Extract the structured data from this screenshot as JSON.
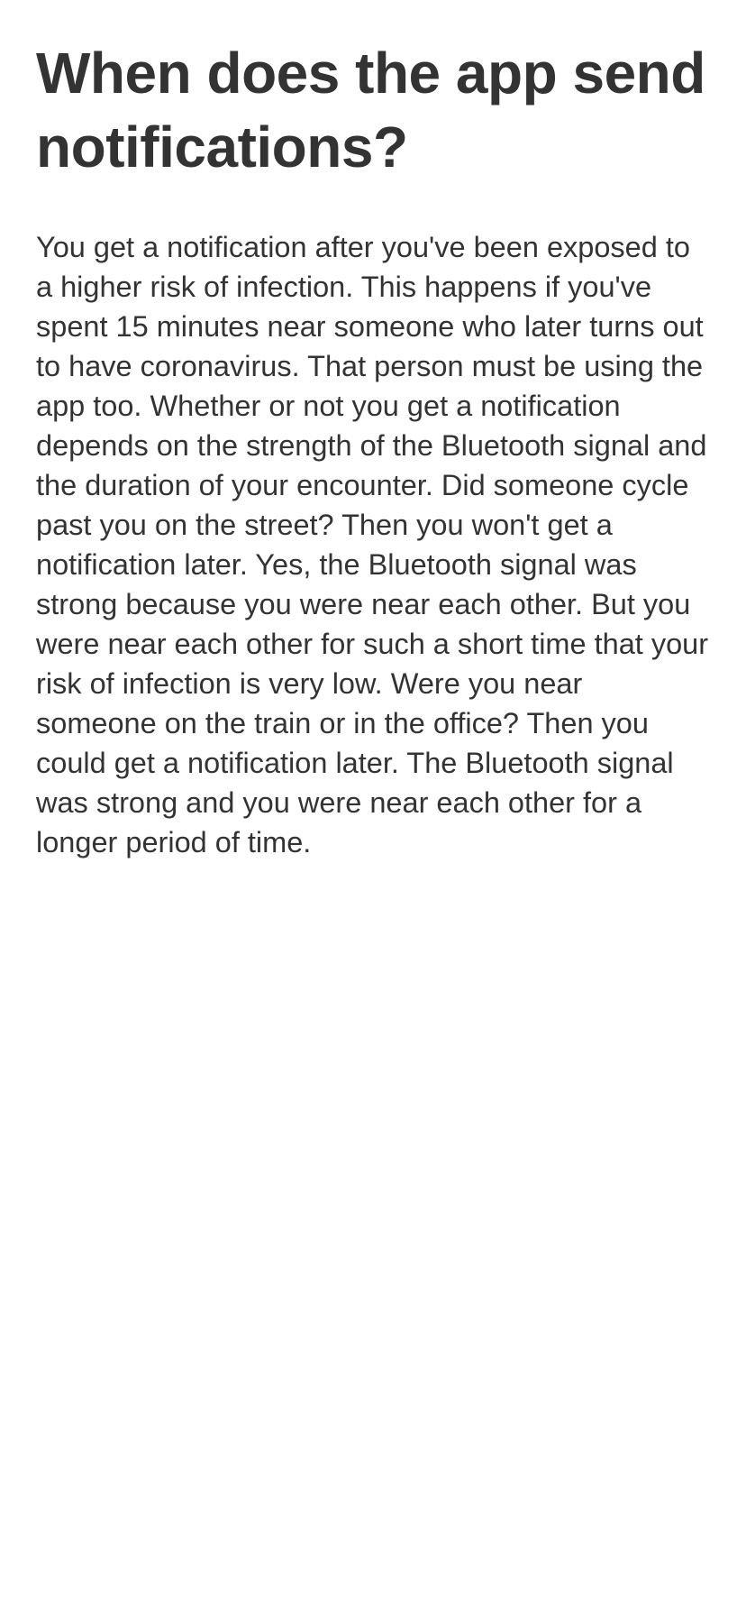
{
  "content": {
    "title": "When does the app send notifications?",
    "body": "You get a notification after you've been exposed to a higher risk of infection. This happens if you've spent 15 minutes near someone who later turns out to have coronavirus. That person must be using the app too. Whether or not you get a notification depends on the strength of the Bluetooth signal and the duration of your encounter. Did someone cycle past you on the street? Then you won't get a notification later. Yes, the Bluetooth signal was strong because you were near each other. But you were near each other for such a short time that your risk of infection is very low. Were you near someone on the train or in the office? Then you could get a notification later. The Bluetooth signal was strong and you were near each other for a longer period of time."
  },
  "colors": {
    "text": "#333333",
    "background": "#ffffff"
  }
}
